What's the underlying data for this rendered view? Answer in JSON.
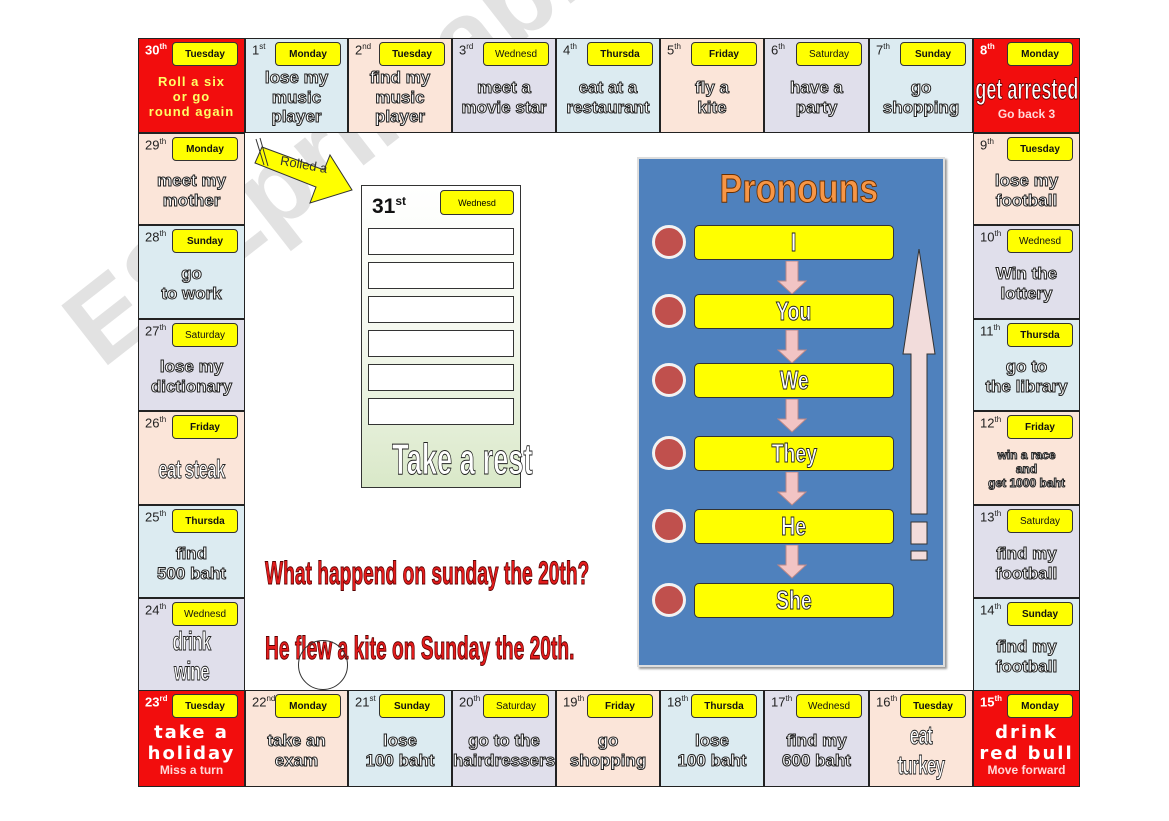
{
  "board": {
    "top_row": [
      {
        "num": "30",
        "suffix": "th",
        "day": "Tuesday",
        "lines": [
          "Roll a six",
          "or go",
          "round again"
        ],
        "style": "red"
      },
      {
        "num": "1",
        "suffix": "st",
        "day": "Monday",
        "lines": [
          "lose my",
          "music player"
        ],
        "style": "blue"
      },
      {
        "num": "2",
        "suffix": "nd",
        "day": "Tuesday",
        "lines": [
          "find my",
          "music player"
        ],
        "style": "peach"
      },
      {
        "num": "3",
        "suffix": "rd",
        "day": "Wednesd",
        "lines": [
          "meet a",
          "movie star"
        ],
        "style": "lav"
      },
      {
        "num": "4",
        "suffix": "th",
        "day": "Thursda",
        "lines": [
          "eat at a",
          "restaurant"
        ],
        "style": "blue"
      },
      {
        "num": "5",
        "suffix": "th",
        "day": "Friday",
        "lines": [
          "fly a",
          "kite"
        ],
        "style": "peach"
      },
      {
        "num": "6",
        "suffix": "th",
        "day": "Saturday",
        "lines": [
          "have a",
          "party"
        ],
        "style": "lav"
      },
      {
        "num": "7",
        "suffix": "th",
        "day": "Sunday",
        "lines": [
          "go",
          "shopping"
        ],
        "style": "blue"
      },
      {
        "num": "8",
        "suffix": "th",
        "day": "Monday",
        "lines": [
          "get arrested",
          "Go back 3"
        ],
        "style": "red"
      }
    ],
    "right_col": [
      {
        "num": "9",
        "suffix": "th",
        "day": "Tuesday",
        "lines": [
          "lose my",
          "football"
        ],
        "style": "peach"
      },
      {
        "num": "10",
        "suffix": "th",
        "day": "Wednesd",
        "lines": [
          "Win the",
          "lottery"
        ],
        "style": "lav"
      },
      {
        "num": "11",
        "suffix": "th",
        "day": "Thursda",
        "lines": [
          "go to",
          "the library"
        ],
        "style": "blue"
      },
      {
        "num": "12",
        "suffix": "th",
        "day": "Friday",
        "lines": [
          "win a race",
          "and",
          "get 1000 baht"
        ],
        "style": "peach"
      },
      {
        "num": "13",
        "suffix": "th",
        "day": "Saturday",
        "lines": [
          "find my",
          "football"
        ],
        "style": "lav"
      },
      {
        "num": "14",
        "suffix": "th",
        "day": "Sunday",
        "lines": [
          "find my",
          "football"
        ],
        "style": "blue"
      }
    ],
    "bottom_row": [
      {
        "num": "23",
        "suffix": "rd",
        "day": "Tuesday",
        "lines": [
          "take a",
          "holiday",
          "Miss a turn"
        ],
        "style": "red"
      },
      {
        "num": "22",
        "suffix": "nd",
        "day": "Monday",
        "lines": [
          "take an",
          "exam"
        ],
        "style": "peach"
      },
      {
        "num": "21",
        "suffix": "st",
        "day": "Sunday",
        "lines": [
          "lose",
          "100 baht"
        ],
        "style": "blue"
      },
      {
        "num": "20",
        "suffix": "th",
        "day": "Saturday",
        "lines": [
          "go to the",
          "hairdressers"
        ],
        "style": "lav"
      },
      {
        "num": "19",
        "suffix": "th",
        "day": "Friday",
        "lines": [
          "go",
          "shopping"
        ],
        "style": "peach"
      },
      {
        "num": "18",
        "suffix": "th",
        "day": "Thursda",
        "lines": [
          "lose",
          "100 baht"
        ],
        "style": "blue"
      },
      {
        "num": "17",
        "suffix": "th",
        "day": "Wednesd",
        "lines": [
          "find my",
          "600 baht"
        ],
        "style": "lav"
      },
      {
        "num": "16",
        "suffix": "th",
        "day": "Tuesday",
        "lines": [
          "eat turkey"
        ],
        "style": "peach"
      },
      {
        "num": "15",
        "suffix": "th",
        "day": "Monday",
        "lines": [
          "drink",
          "red bull",
          "Move forward"
        ],
        "style": "red"
      }
    ],
    "left_col": [
      {
        "num": "29",
        "suffix": "th",
        "day": "Monday",
        "lines": [
          "meet my",
          "mother"
        ],
        "style": "peach"
      },
      {
        "num": "28",
        "suffix": "th",
        "day": "Sunday",
        "lines": [
          "go",
          "to work"
        ],
        "style": "blue"
      },
      {
        "num": "27",
        "suffix": "th",
        "day": "Saturday",
        "lines": [
          "lose my",
          "dictionary"
        ],
        "style": "lav"
      },
      {
        "num": "26",
        "suffix": "th",
        "day": "Friday",
        "lines": [
          "eat steak"
        ],
        "style": "peach"
      },
      {
        "num": "25",
        "suffix": "th",
        "day": "Thursda",
        "lines": [
          "find",
          "500 baht"
        ],
        "style": "blue"
      },
      {
        "num": "24",
        "suffix": "th",
        "day": "Wednesd",
        "lines": [
          "drink wine"
        ],
        "style": "lav"
      }
    ]
  },
  "rolled_label": "Rolled a",
  "card31": {
    "num": "31",
    "suffix": "st",
    "day": "Wednesd",
    "blank_lines": 6,
    "footer": "Take a rest"
  },
  "pronouns": {
    "title": "Pronouns",
    "items": [
      "I",
      "You",
      "We",
      "They",
      "He",
      "She"
    ]
  },
  "question": "What happend on sunday the 20th?",
  "answer": "He flew a kite on Sunday the 20th.",
  "watermark": "ESLprintables.com"
}
